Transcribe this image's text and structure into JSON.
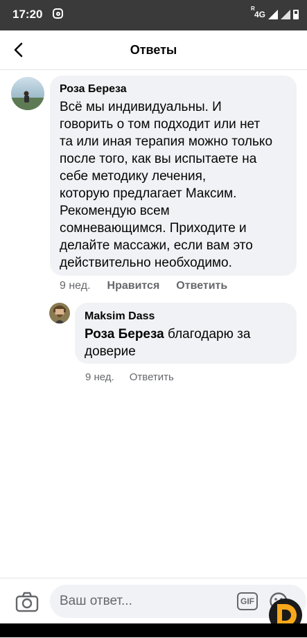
{
  "status_bar": {
    "time": "17:20",
    "network": "4G",
    "roaming": "R"
  },
  "header": {
    "title": "Ответы"
  },
  "comment": {
    "author": "Роза Береза",
    "text": "Всё мы индивидуальны. И\nговорить о том подходит или нет\nта или иная терапия можно только\nпосле того, как вы испытаете на\nсебе методику лечения,\nкоторую предлагает Максим.\nРекомендую всем\nсомневающимся. Приходите и\nделайте массажи, если вам это\nдействительно необходимо.",
    "time": "9 нед.",
    "like_label": "Нравится",
    "reply_label": "Ответить"
  },
  "reply": {
    "author": "Maksim Dass",
    "mention": "Роза Береза",
    "text": " благодарю за\nдоверие",
    "time": "9 нед.",
    "reply_label": "Ответить"
  },
  "composer": {
    "placeholder": "Ваш ответ...",
    "gif_label": "GIF"
  },
  "colors": {
    "bubble": "#f0f2f5",
    "meta": "#65676b",
    "status_bar": "#3a3a3a",
    "logo_orange": "#f7a81b"
  }
}
